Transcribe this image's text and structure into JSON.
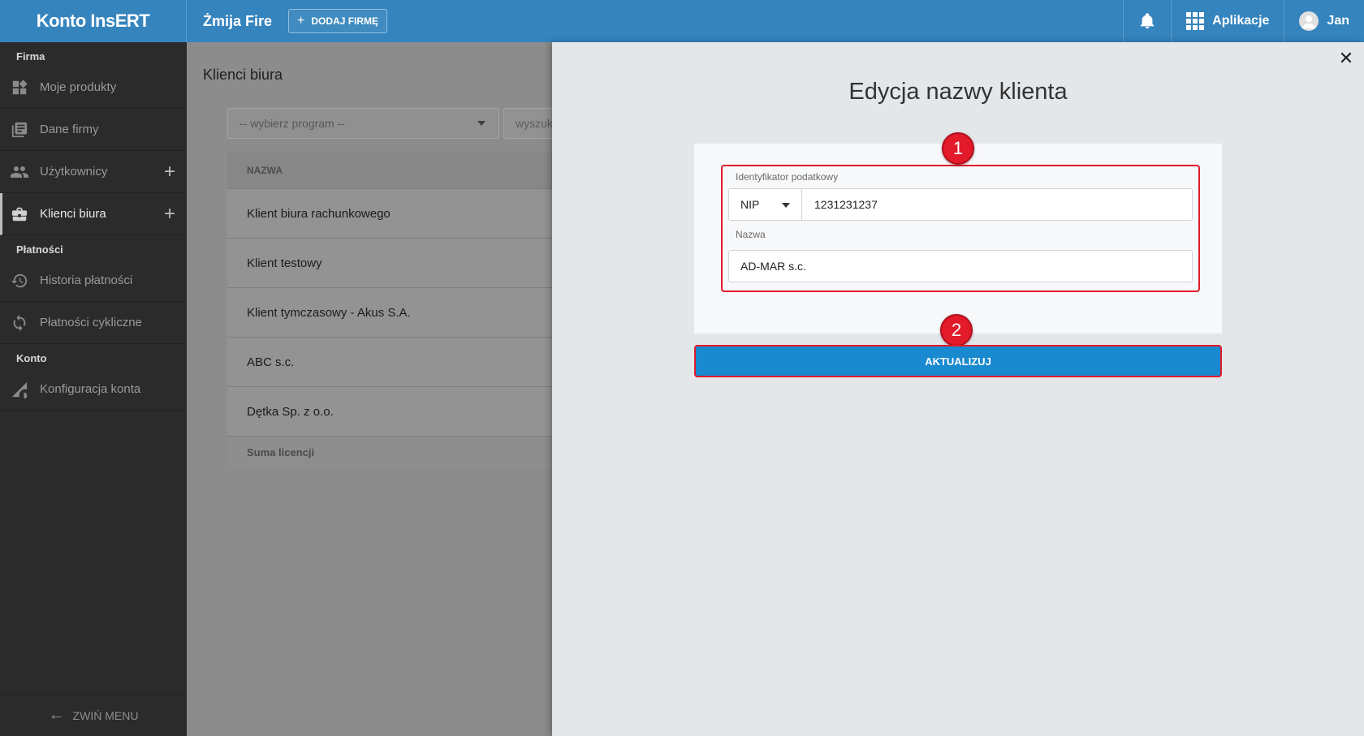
{
  "topbar": {
    "brand": "Konto InsERT",
    "company": "Żmija Fire",
    "add_company": "DODAJ FIRMĘ",
    "apps": "Aplikacje",
    "user": "Jan"
  },
  "sidebar": {
    "sections": [
      {
        "label": "Firma"
      },
      {
        "label": "Płatności"
      },
      {
        "label": "Konto"
      }
    ],
    "items": [
      {
        "label": "Moje produkty"
      },
      {
        "label": "Dane firmy"
      },
      {
        "label": "Użytkownicy"
      },
      {
        "label": "Klienci biura"
      },
      {
        "label": "Historia płatności"
      },
      {
        "label": "Płatności cykliczne"
      },
      {
        "label": "Konfiguracja konta"
      }
    ],
    "collapse": "ZWIŃ MENU"
  },
  "main": {
    "title": "Klienci biura",
    "select_placeholder": "-- wybierz program --",
    "search_placeholder": "wyszuk",
    "column_header": "NAZWA",
    "rows": [
      "Klient biura rachunkowego",
      "Klient testowy",
      "Klient tymczasowy - Akus S.A.",
      "ABC s.c.",
      "Dętka Sp. z o.o."
    ],
    "footer": "Suma licencji"
  },
  "panel": {
    "title": "Edycja nazwy klienta",
    "tax_label": "Identyfikator podatkowy",
    "tax_type": "NIP",
    "tax_value": "1231231237",
    "name_label": "Nazwa",
    "name_value": "AD-MAR s.c.",
    "update_button": "AKTUALIZUJ",
    "badge1": "1",
    "badge2": "2"
  },
  "colors": {
    "topbar": "#3584bd",
    "sidebar": "#2b2b2b",
    "button": "#1a8ad0",
    "highlight": "#e21a2a"
  }
}
